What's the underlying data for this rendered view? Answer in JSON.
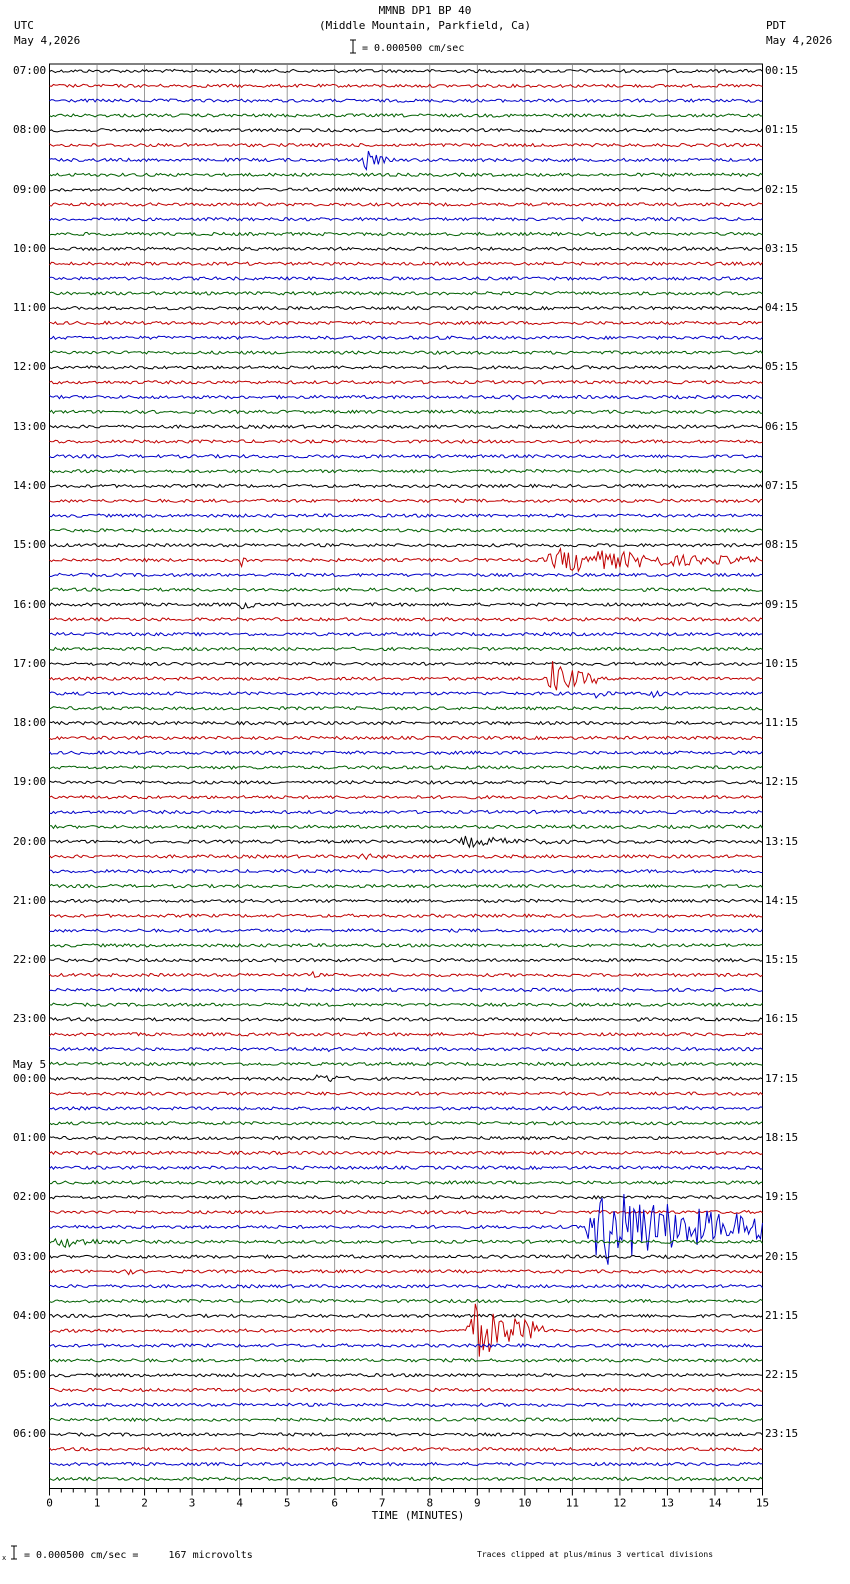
{
  "header": {
    "title": "MMNB DP1 BP 40",
    "subtitle": "(Middle Mountain, Parkfield, Ca)",
    "left_tz": "UTC",
    "left_date": "May 4,2026",
    "right_tz": "PDT",
    "right_date": "May 4,2026",
    "scale_label": "= 0.000500 cm/sec"
  },
  "footer": {
    "scale_note": "= 0.000500 cm/sec =     167 microvolts",
    "clip_note": "Traces clipped at plus/minus 3 vertical divisions"
  },
  "colors": {
    "trace_cycle": [
      "#000000",
      "#c00000",
      "#0000c8",
      "#006000"
    ],
    "grid": "#808080"
  },
  "chart_data": {
    "type": "line",
    "xlabel": "TIME (MINUTES)",
    "xlim": [
      0,
      15
    ],
    "x_ticks": [
      0,
      1,
      2,
      3,
      4,
      5,
      6,
      7,
      8,
      9,
      10,
      11,
      12,
      13,
      14,
      15
    ],
    "trace_count": 96,
    "traces_per_hour": 4,
    "date_change": {
      "hour_index": 17,
      "label": "May 5"
    },
    "left_hour_labels": [
      "07:00",
      "08:00",
      "09:00",
      "10:00",
      "11:00",
      "12:00",
      "13:00",
      "14:00",
      "15:00",
      "16:00",
      "17:00",
      "18:00",
      "19:00",
      "20:00",
      "21:00",
      "22:00",
      "23:00",
      "00:00",
      "01:00",
      "02:00",
      "03:00",
      "04:00",
      "05:00",
      "06:00"
    ],
    "right_hour_labels": [
      "00:15",
      "01:15",
      "02:15",
      "03:15",
      "04:15",
      "05:15",
      "06:15",
      "07:15",
      "08:15",
      "09:15",
      "10:15",
      "11:15",
      "12:15",
      "13:15",
      "14:15",
      "15:15",
      "16:15",
      "17:15",
      "18:15",
      "19:15",
      "20:15",
      "21:15",
      "22:15",
      "23:15"
    ],
    "events": [
      {
        "trace": 6,
        "start": 6.55,
        "end": 7.1,
        "amp": 12
      },
      {
        "trace": 22,
        "start": 9.6,
        "end": 10.0,
        "amp": 4
      },
      {
        "trace": 33,
        "start": 4.0,
        "end": 4.2,
        "amp": 9
      },
      {
        "trace": 33,
        "start": 10.25,
        "end": 15.0,
        "amp": 13
      },
      {
        "trace": 36,
        "start": 3.95,
        "end": 4.3,
        "amp": 9
      },
      {
        "trace": 41,
        "start": 10.45,
        "end": 11.5,
        "amp": 18
      },
      {
        "trace": 42,
        "start": 11.45,
        "end": 11.85,
        "amp": 6
      },
      {
        "trace": 42,
        "start": 12.6,
        "end": 13.0,
        "amp": 6
      },
      {
        "trace": 52,
        "start": 8.4,
        "end": 11.3,
        "amp": 6
      },
      {
        "trace": 53,
        "start": 6.4,
        "end": 7.6,
        "amp": 4
      },
      {
        "trace": 61,
        "start": 5.5,
        "end": 5.75,
        "amp": 4
      },
      {
        "trace": 66,
        "start": 5.85,
        "end": 6.05,
        "amp": 5
      },
      {
        "trace": 68,
        "start": 5.5,
        "end": 6.6,
        "amp": 6
      },
      {
        "trace": 78,
        "start": 11.2,
        "end": 15.0,
        "amp": 44
      },
      {
        "trace": 79,
        "start": 0.0,
        "end": 1.6,
        "amp": 7
      },
      {
        "trace": 81,
        "start": 1.6,
        "end": 2.0,
        "amp": 4
      },
      {
        "trace": 85,
        "start": 8.75,
        "end": 10.4,
        "amp": 30
      }
    ]
  }
}
